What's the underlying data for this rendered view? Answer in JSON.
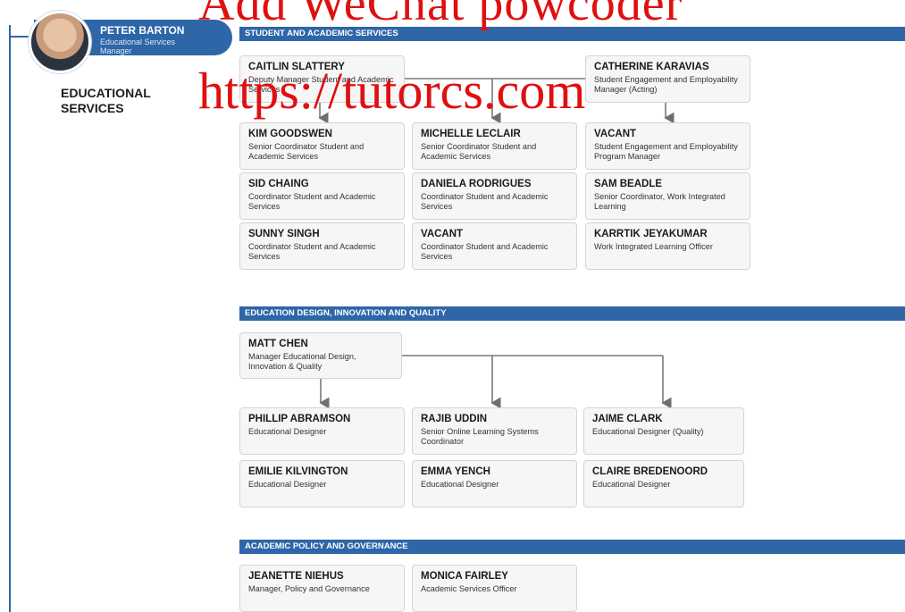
{
  "manager": {
    "name": "PETER BARTON",
    "title": "Educational Services Manager"
  },
  "section_label": "EDUCATIONAL SERVICES",
  "watermark": {
    "line1": "Add WeChat powcoder",
    "line2": "https://tutorcs.com"
  },
  "colors": {
    "band": "#2e66a8",
    "watermark": "#e01010",
    "card_bg": "#f6f6f6"
  },
  "sections": [
    {
      "title": "STUDENT AND ACADEMIC SERVICES",
      "heads": [
        {
          "name": "CAITLIN SLATTERY",
          "title": "Deputy Manager Student and Academic Services"
        },
        {
          "name": "CATHERINE KARAVIAS",
          "title": "Student Engagement and Employability Manager (Acting)"
        }
      ],
      "cards": [
        {
          "name": "KIM GOODSWEN",
          "title": "Senior Coordinator Student and Academic Services"
        },
        {
          "name": "MICHELLE LECLAIR",
          "title": "Senior Coordinator Student and Academic Services"
        },
        {
          "name": "VACANT",
          "title": "Student Engagement and Employability Program Manager"
        },
        {
          "name": "SID CHAING",
          "title": "Coordinator Student and Academic Services"
        },
        {
          "name": "DANIELA RODRIGUES",
          "title": "Coordinator Student and Academic Services"
        },
        {
          "name": "SAM BEADLE",
          "title": "Senior Coordinator, Work Integrated Learning"
        },
        {
          "name": "SUNNY SINGH",
          "title": "Coordinator Student and Academic Services"
        },
        {
          "name": "VACANT",
          "title": "Coordinator Student and Academic Services"
        },
        {
          "name": "KARRTIK JEYAKUMAR",
          "title": "Work Integrated Learning Officer"
        }
      ]
    },
    {
      "title": "EDUCATION DESIGN, INNOVATION AND QUALITY",
      "heads": [
        {
          "name": "MATT CHEN",
          "title": "Manager Educational Design, Innovation & Quality"
        }
      ],
      "cards": [
        {
          "name": "PHILLIP ABRAMSON",
          "title": "Educational Designer"
        },
        {
          "name": "RAJIB UDDIN",
          "title": "Senior Online Learning Systems Coordinator"
        },
        {
          "name": "JAIME CLARK",
          "title": "Educational Designer (Quality)"
        },
        {
          "name": "EMILIE KILVINGTON",
          "title": "Educational Designer"
        },
        {
          "name": "EMMA YENCH",
          "title": "Educational Designer"
        },
        {
          "name": "CLAIRE BREDENOORD",
          "title": "Educational Designer"
        }
      ]
    },
    {
      "title": "ACADEMIC POLICY AND GOVERNANCE",
      "cards": [
        {
          "name": "JEANETTE NIEHUS",
          "title": "Manager, Policy and Governance"
        },
        {
          "name": "MONICA FAIRLEY",
          "title": "Academic Services Officer"
        }
      ]
    }
  ]
}
